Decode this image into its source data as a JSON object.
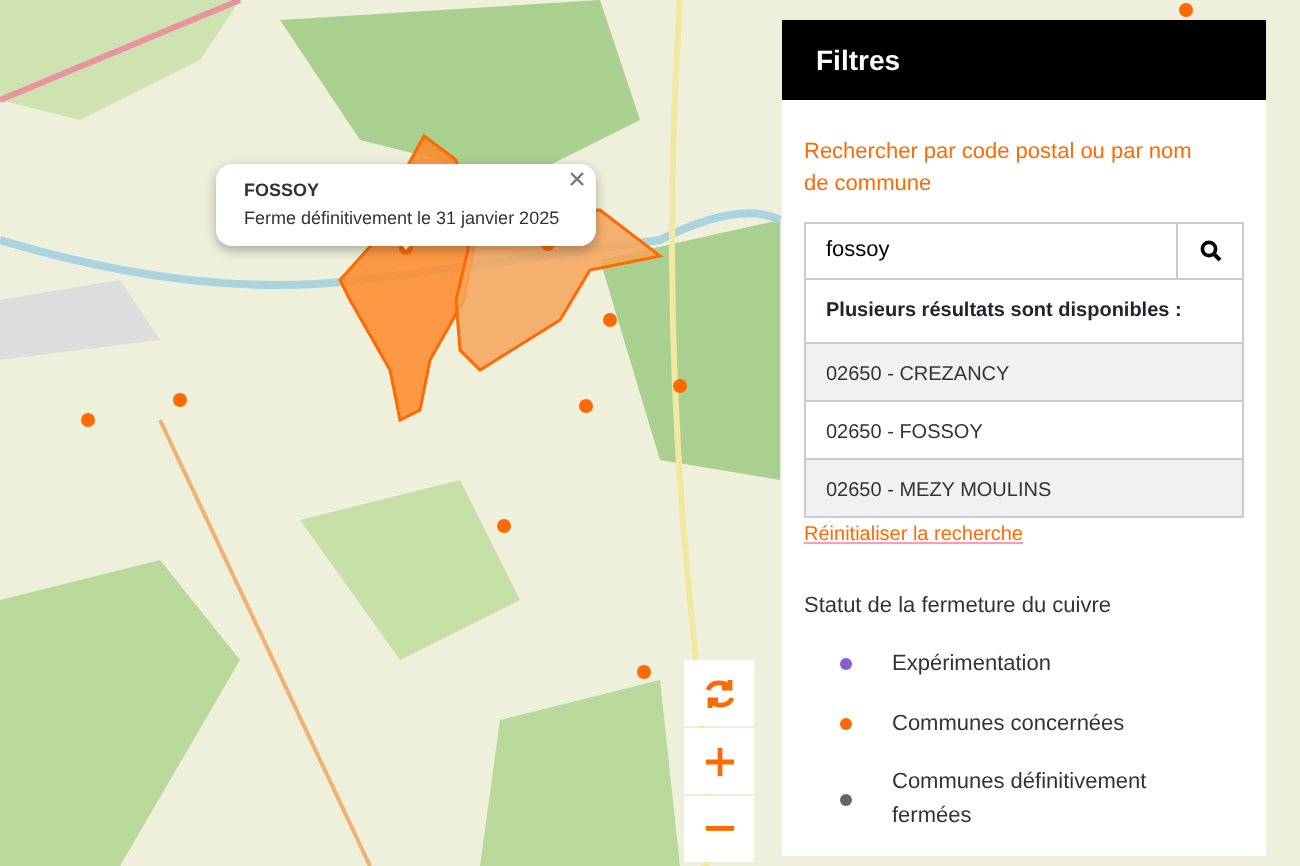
{
  "map": {
    "popup": {
      "title": "FOSSOY",
      "text": "Ferme définitivement le 31 janvier 2025"
    },
    "controls": [
      {
        "kind": "refresh"
      },
      {
        "kind": "zoom-in"
      },
      {
        "kind": "zoom-out"
      }
    ]
  },
  "filters": {
    "title": "Filtres",
    "search_label": "Rechercher par code postal ou par nom de commune",
    "search": {
      "value": "fossoy"
    },
    "results_heading": "Plusieurs résultats sont disponibles :",
    "results": [
      {
        "label": "02650 - CREZANCY"
      },
      {
        "label": "02650 - FOSSOY"
      },
      {
        "label": "02650 - MEZY MOULINS"
      }
    ],
    "reset_link": "Réinitialiser la recherche",
    "status_heading": "Statut de la fermeture du cuivre",
    "legend": [
      {
        "label": "Expérimentation",
        "color": "#8e5bd0"
      },
      {
        "label": "Communes concernées",
        "color": "#ff6a00"
      },
      {
        "label": "Communes définitivement fermées",
        "color": "#666666"
      }
    ]
  }
}
